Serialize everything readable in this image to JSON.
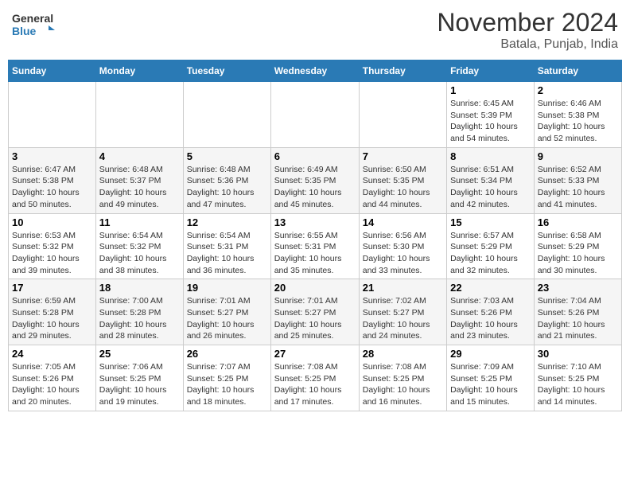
{
  "header": {
    "logo": {
      "line1": "General",
      "line2": "Blue"
    },
    "title": "November 2024",
    "location": "Batala, Punjab, India"
  },
  "days_of_week": [
    "Sunday",
    "Monday",
    "Tuesday",
    "Wednesday",
    "Thursday",
    "Friday",
    "Saturday"
  ],
  "weeks": [
    {
      "days": [
        {
          "date": "",
          "info": ""
        },
        {
          "date": "",
          "info": ""
        },
        {
          "date": "",
          "info": ""
        },
        {
          "date": "",
          "info": ""
        },
        {
          "date": "",
          "info": ""
        },
        {
          "date": "1",
          "info": "Sunrise: 6:45 AM\nSunset: 5:39 PM\nDaylight: 10 hours\nand 54 minutes."
        },
        {
          "date": "2",
          "info": "Sunrise: 6:46 AM\nSunset: 5:38 PM\nDaylight: 10 hours\nand 52 minutes."
        }
      ]
    },
    {
      "days": [
        {
          "date": "3",
          "info": "Sunrise: 6:47 AM\nSunset: 5:38 PM\nDaylight: 10 hours\nand 50 minutes."
        },
        {
          "date": "4",
          "info": "Sunrise: 6:48 AM\nSunset: 5:37 PM\nDaylight: 10 hours\nand 49 minutes."
        },
        {
          "date": "5",
          "info": "Sunrise: 6:48 AM\nSunset: 5:36 PM\nDaylight: 10 hours\nand 47 minutes."
        },
        {
          "date": "6",
          "info": "Sunrise: 6:49 AM\nSunset: 5:35 PM\nDaylight: 10 hours\nand 45 minutes."
        },
        {
          "date": "7",
          "info": "Sunrise: 6:50 AM\nSunset: 5:35 PM\nDaylight: 10 hours\nand 44 minutes."
        },
        {
          "date": "8",
          "info": "Sunrise: 6:51 AM\nSunset: 5:34 PM\nDaylight: 10 hours\nand 42 minutes."
        },
        {
          "date": "9",
          "info": "Sunrise: 6:52 AM\nSunset: 5:33 PM\nDaylight: 10 hours\nand 41 minutes."
        }
      ]
    },
    {
      "days": [
        {
          "date": "10",
          "info": "Sunrise: 6:53 AM\nSunset: 5:32 PM\nDaylight: 10 hours\nand 39 minutes."
        },
        {
          "date": "11",
          "info": "Sunrise: 6:54 AM\nSunset: 5:32 PM\nDaylight: 10 hours\nand 38 minutes."
        },
        {
          "date": "12",
          "info": "Sunrise: 6:54 AM\nSunset: 5:31 PM\nDaylight: 10 hours\nand 36 minutes."
        },
        {
          "date": "13",
          "info": "Sunrise: 6:55 AM\nSunset: 5:31 PM\nDaylight: 10 hours\nand 35 minutes."
        },
        {
          "date": "14",
          "info": "Sunrise: 6:56 AM\nSunset: 5:30 PM\nDaylight: 10 hours\nand 33 minutes."
        },
        {
          "date": "15",
          "info": "Sunrise: 6:57 AM\nSunset: 5:29 PM\nDaylight: 10 hours\nand 32 minutes."
        },
        {
          "date": "16",
          "info": "Sunrise: 6:58 AM\nSunset: 5:29 PM\nDaylight: 10 hours\nand 30 minutes."
        }
      ]
    },
    {
      "days": [
        {
          "date": "17",
          "info": "Sunrise: 6:59 AM\nSunset: 5:28 PM\nDaylight: 10 hours\nand 29 minutes."
        },
        {
          "date": "18",
          "info": "Sunrise: 7:00 AM\nSunset: 5:28 PM\nDaylight: 10 hours\nand 28 minutes."
        },
        {
          "date": "19",
          "info": "Sunrise: 7:01 AM\nSunset: 5:27 PM\nDaylight: 10 hours\nand 26 minutes."
        },
        {
          "date": "20",
          "info": "Sunrise: 7:01 AM\nSunset: 5:27 PM\nDaylight: 10 hours\nand 25 minutes."
        },
        {
          "date": "21",
          "info": "Sunrise: 7:02 AM\nSunset: 5:27 PM\nDaylight: 10 hours\nand 24 minutes."
        },
        {
          "date": "22",
          "info": "Sunrise: 7:03 AM\nSunset: 5:26 PM\nDaylight: 10 hours\nand 23 minutes."
        },
        {
          "date": "23",
          "info": "Sunrise: 7:04 AM\nSunset: 5:26 PM\nDaylight: 10 hours\nand 21 minutes."
        }
      ]
    },
    {
      "days": [
        {
          "date": "24",
          "info": "Sunrise: 7:05 AM\nSunset: 5:26 PM\nDaylight: 10 hours\nand 20 minutes."
        },
        {
          "date": "25",
          "info": "Sunrise: 7:06 AM\nSunset: 5:25 PM\nDaylight: 10 hours\nand 19 minutes."
        },
        {
          "date": "26",
          "info": "Sunrise: 7:07 AM\nSunset: 5:25 PM\nDaylight: 10 hours\nand 18 minutes."
        },
        {
          "date": "27",
          "info": "Sunrise: 7:08 AM\nSunset: 5:25 PM\nDaylight: 10 hours\nand 17 minutes."
        },
        {
          "date": "28",
          "info": "Sunrise: 7:08 AM\nSunset: 5:25 PM\nDaylight: 10 hours\nand 16 minutes."
        },
        {
          "date": "29",
          "info": "Sunrise: 7:09 AM\nSunset: 5:25 PM\nDaylight: 10 hours\nand 15 minutes."
        },
        {
          "date": "30",
          "info": "Sunrise: 7:10 AM\nSunset: 5:25 PM\nDaylight: 10 hours\nand 14 minutes."
        }
      ]
    }
  ]
}
